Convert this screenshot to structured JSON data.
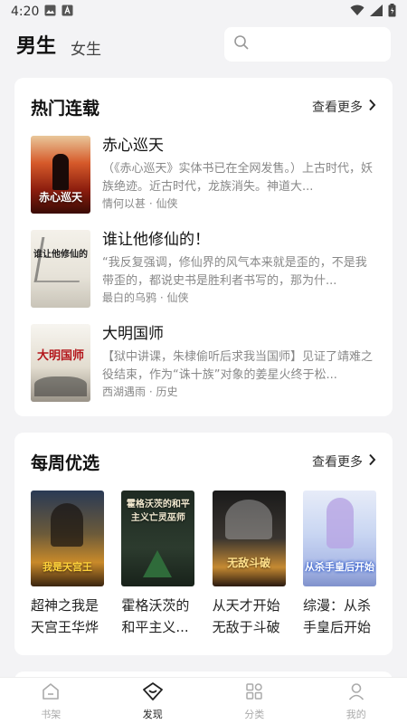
{
  "status_bar": {
    "time": "4:20"
  },
  "header": {
    "tab_male": "男生",
    "tab_female": "女生"
  },
  "hot_section": {
    "title": "热门连载",
    "more_label": "查看更多",
    "books": [
      {
        "title": "赤心巡天",
        "desc": "（《赤心巡天》实体书已在全网发售。）上古时代，妖族绝迹。近古时代，龙族消失。神道大...",
        "meta": "情何以甚 · 仙侠",
        "cover_text": "赤心巡天"
      },
      {
        "title": "谁让他修仙的！",
        "desc": "“我反复强调，修仙界的风气本来就是歪的，不是我带歪的，都说史书是胜利者书写的，那为什...",
        "meta": "最白的乌鸦 · 仙侠",
        "cover_text": "谁让他修仙的"
      },
      {
        "title": "大明国师",
        "desc": "【狱中讲课，朱棣偷听后求我当国师】见证了靖难之役结束，作为“诛十族”对象的姜星火终于松...",
        "meta": "西湖遇雨 · 历史",
        "cover_text": "大明国师"
      }
    ]
  },
  "weekly_section": {
    "title": "每周优选",
    "more_label": "查看更多",
    "books": [
      {
        "title": "超神之我是天宫王华烨",
        "cover_text": "我是天宫王"
      },
      {
        "title": "霍格沃茨的和平主义...",
        "cover_text": "霍格沃茨的和平主义亡灵巫师"
      },
      {
        "title": "从天才开始无敌于斗破",
        "cover_text": "无敌斗破"
      },
      {
        "title": "综漫：从杀手皇后开始",
        "cover_text": "从杀手皇后开始"
      }
    ]
  },
  "bottom_nav": {
    "items": [
      {
        "label": "书架",
        "icon": "home-icon"
      },
      {
        "label": "发现",
        "icon": "discover-icon"
      },
      {
        "label": "分类",
        "icon": "category-icon"
      },
      {
        "label": "我的",
        "icon": "profile-icon"
      }
    ]
  },
  "colors": {
    "accent": "#222222",
    "muted": "#aaaaaa",
    "background": "#f3f3f5"
  }
}
